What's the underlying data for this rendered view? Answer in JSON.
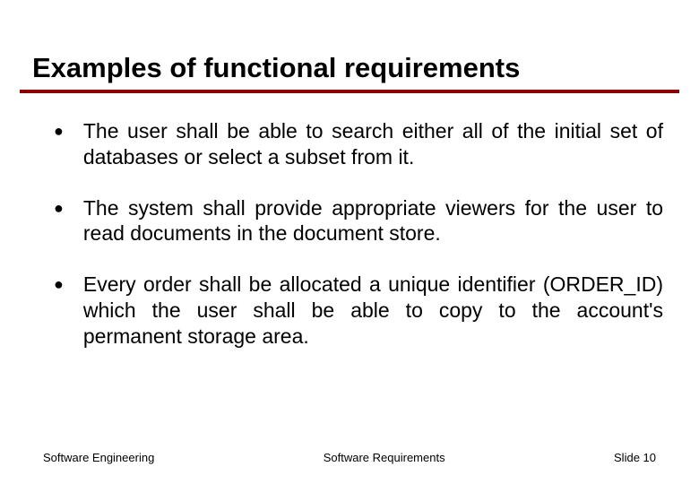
{
  "title": "Examples of functional requirements",
  "bullets": [
    "The user shall be able to search either all of the initial set of databases or select a subset from it.",
    "The system shall provide appropriate viewers for the user to read documents in the document store.",
    "Every order shall be allocated a unique identifier (ORDER_ID) which the user shall be able to copy to the account's permanent storage area."
  ],
  "footer": {
    "left": "Software Engineering",
    "center": "Software Requirements",
    "right": "Slide 10"
  }
}
